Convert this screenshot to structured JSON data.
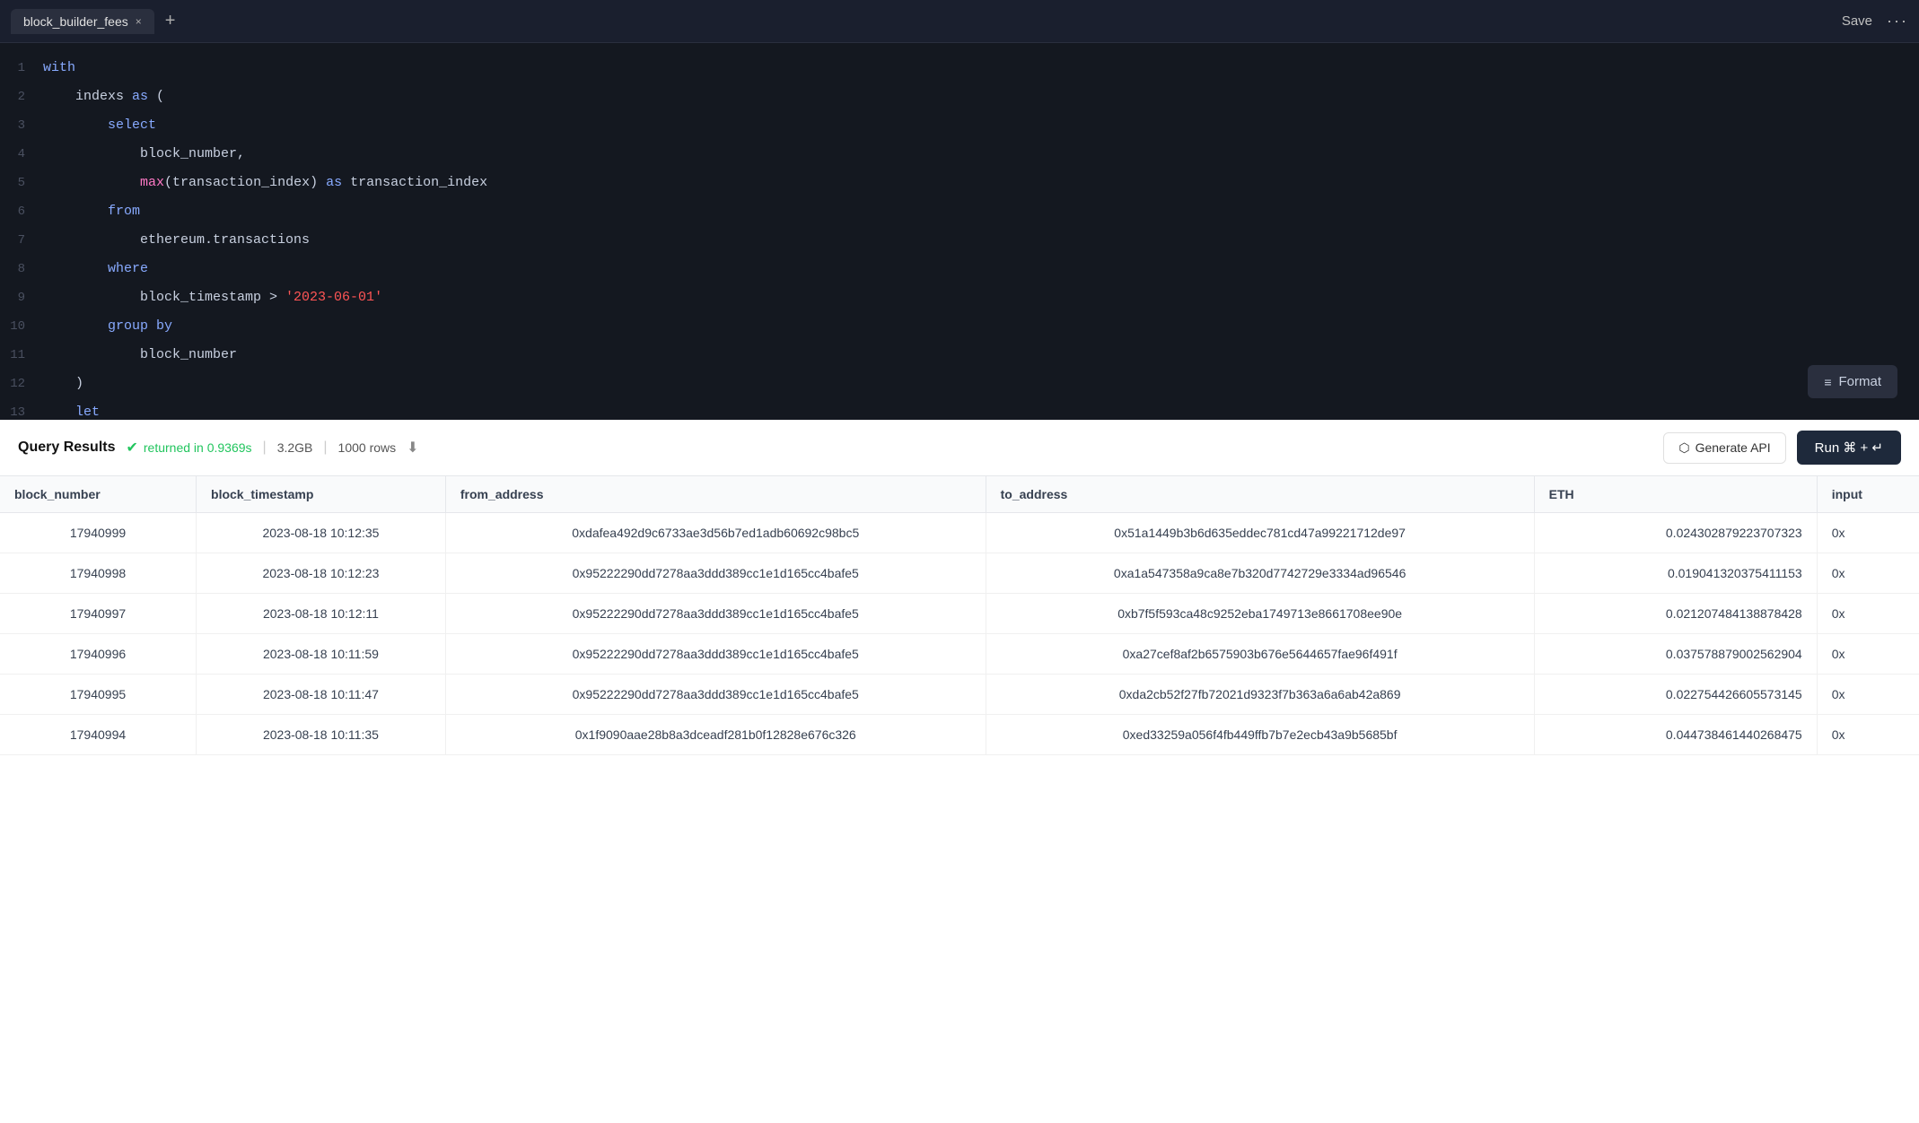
{
  "tab": {
    "name": "block_builder_fees",
    "close_label": "×",
    "add_label": "+"
  },
  "toolbar": {
    "save_label": "Save",
    "more_label": "···"
  },
  "editor": {
    "lines": [
      {
        "num": 1,
        "tokens": [
          {
            "text": "with",
            "cls": "kw-with"
          }
        ]
      },
      {
        "num": 2,
        "tokens": [
          {
            "text": "    indexs ",
            "cls": "plain"
          },
          {
            "text": "as",
            "cls": "kw-as"
          },
          {
            "text": " (",
            "cls": "plain"
          }
        ]
      },
      {
        "num": 3,
        "tokens": [
          {
            "text": "        ",
            "cls": "plain"
          },
          {
            "text": "select",
            "cls": "kw-select"
          }
        ]
      },
      {
        "num": 4,
        "tokens": [
          {
            "text": "            block_number,",
            "cls": "plain"
          }
        ]
      },
      {
        "num": 5,
        "tokens": [
          {
            "text": "            ",
            "cls": "plain"
          },
          {
            "text": "max",
            "cls": "fn-max"
          },
          {
            "text": "(transaction_index) ",
            "cls": "plain"
          },
          {
            "text": "as",
            "cls": "kw-as"
          },
          {
            "text": " transaction_index",
            "cls": "plain"
          }
        ]
      },
      {
        "num": 6,
        "tokens": [
          {
            "text": "        ",
            "cls": "plain"
          },
          {
            "text": "from",
            "cls": "kw-from"
          }
        ]
      },
      {
        "num": 7,
        "tokens": [
          {
            "text": "            ethereum.transactions",
            "cls": "plain"
          }
        ]
      },
      {
        "num": 8,
        "tokens": [
          {
            "text": "        ",
            "cls": "plain"
          },
          {
            "text": "where",
            "cls": "kw-where"
          }
        ]
      },
      {
        "num": 9,
        "tokens": [
          {
            "text": "            block_timestamp > ",
            "cls": "plain"
          },
          {
            "text": "'2023-06-01'",
            "cls": "str-val"
          }
        ]
      },
      {
        "num": 10,
        "tokens": [
          {
            "text": "        ",
            "cls": "plain"
          },
          {
            "text": "group",
            "cls": "kw-group"
          },
          {
            "text": " ",
            "cls": "plain"
          },
          {
            "text": "by",
            "cls": "kw-by"
          }
        ]
      },
      {
        "num": 11,
        "tokens": [
          {
            "text": "            block_number",
            "cls": "plain"
          }
        ]
      },
      {
        "num": 12,
        "tokens": [
          {
            "text": "    )",
            "cls": "plain"
          }
        ]
      },
      {
        "num": 13,
        "tokens": [
          {
            "text": "    ",
            "cls": "plain"
          },
          {
            "text": "let",
            "cls": "kw-let"
          }
        ]
      }
    ]
  },
  "format_btn": {
    "label": "Format",
    "icon": "≡"
  },
  "results": {
    "title": "Query Results",
    "status": "returned in 0.9369s",
    "size": "3.2GB",
    "rows": "1000 rows",
    "gen_api_label": "Generate API",
    "run_label": "Run ⌘ + ↵"
  },
  "table": {
    "columns": [
      "block_number",
      "block_timestamp",
      "from_address",
      "to_address",
      "ETH",
      "input"
    ],
    "rows": [
      {
        "block_number": "17940999",
        "block_timestamp": "2023-08-18 10:12:35",
        "from_address": "0xdafea492d9c6733ae3d56b7ed1adb60692c98bc5",
        "to_address": "0x51a1449b3b6d635eddec781cd47a99221712de97",
        "eth": "0.024302879223707323",
        "input": "0x"
      },
      {
        "block_number": "17940998",
        "block_timestamp": "2023-08-18 10:12:23",
        "from_address": "0x95222290dd7278aa3ddd389cc1e1d165cc4bafe5",
        "to_address": "0xa1a547358a9ca8e7b320d7742729e3334ad96546",
        "eth": "0.019041320375411153",
        "input": "0x"
      },
      {
        "block_number": "17940997",
        "block_timestamp": "2023-08-18 10:12:11",
        "from_address": "0x95222290dd7278aa3ddd389cc1e1d165cc4bafe5",
        "to_address": "0xb7f5f593ca48c9252eba1749713e8661708ee90e",
        "eth": "0.021207484138878428",
        "input": "0x"
      },
      {
        "block_number": "17940996",
        "block_timestamp": "2023-08-18 10:11:59",
        "from_address": "0x95222290dd7278aa3ddd389cc1e1d165cc4bafe5",
        "to_address": "0xa27cef8af2b6575903b676e5644657fae96f491f",
        "eth": "0.037578879002562904",
        "input": "0x"
      },
      {
        "block_number": "17940995",
        "block_timestamp": "2023-08-18 10:11:47",
        "from_address": "0x95222290dd7278aa3ddd389cc1e1d165cc4bafe5",
        "to_address": "0xda2cb52f27fb72021d9323f7b363a6a6ab42a869",
        "eth": "0.022754426605573145",
        "input": "0x"
      },
      {
        "block_number": "17940994",
        "block_timestamp": "2023-08-18 10:11:35",
        "from_address": "0x1f9090aae28b8a3dceadf281b0f12828e676c326",
        "to_address": "0xed33259a056f4fb449ffb7b7e2ecb43a9b5685bf",
        "eth": "0.044738461440268475",
        "input": "0x"
      }
    ]
  }
}
